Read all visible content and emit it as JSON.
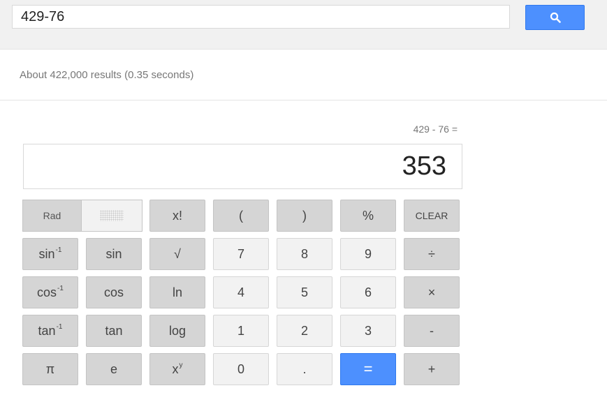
{
  "search": {
    "query": "429-76",
    "button_icon": "search-icon"
  },
  "results": {
    "stats": "About 422,000 results (0.35 seconds)"
  },
  "calculator": {
    "expression": "429 - 76 =",
    "result": "353",
    "mode": {
      "rad_label": "Rad"
    },
    "keys": {
      "factorial": "x!",
      "open_paren": "(",
      "close_paren": ")",
      "percent": "%",
      "clear": "CLEAR",
      "arcsin": "sin",
      "sin": "sin",
      "sqrt": "√",
      "seven": "7",
      "eight": "8",
      "nine": "9",
      "divide": "÷",
      "arccos": "cos",
      "cos": "cos",
      "ln": "ln",
      "four": "4",
      "five": "5",
      "six": "6",
      "multiply": "×",
      "arctan": "tan",
      "tan": "tan",
      "log": "log",
      "one": "1",
      "two": "2",
      "three": "3",
      "minus": "-",
      "pi": "π",
      "e": "e",
      "power": "x",
      "zero": "0",
      "decimal": ".",
      "equals": "=",
      "plus": "+"
    },
    "superscripts": {
      "inverse": "-1",
      "power": "y"
    }
  },
  "colors": {
    "accent": "#4d90fe",
    "key_dark": "#d5d5d5",
    "key_light": "#f2f2f2"
  }
}
